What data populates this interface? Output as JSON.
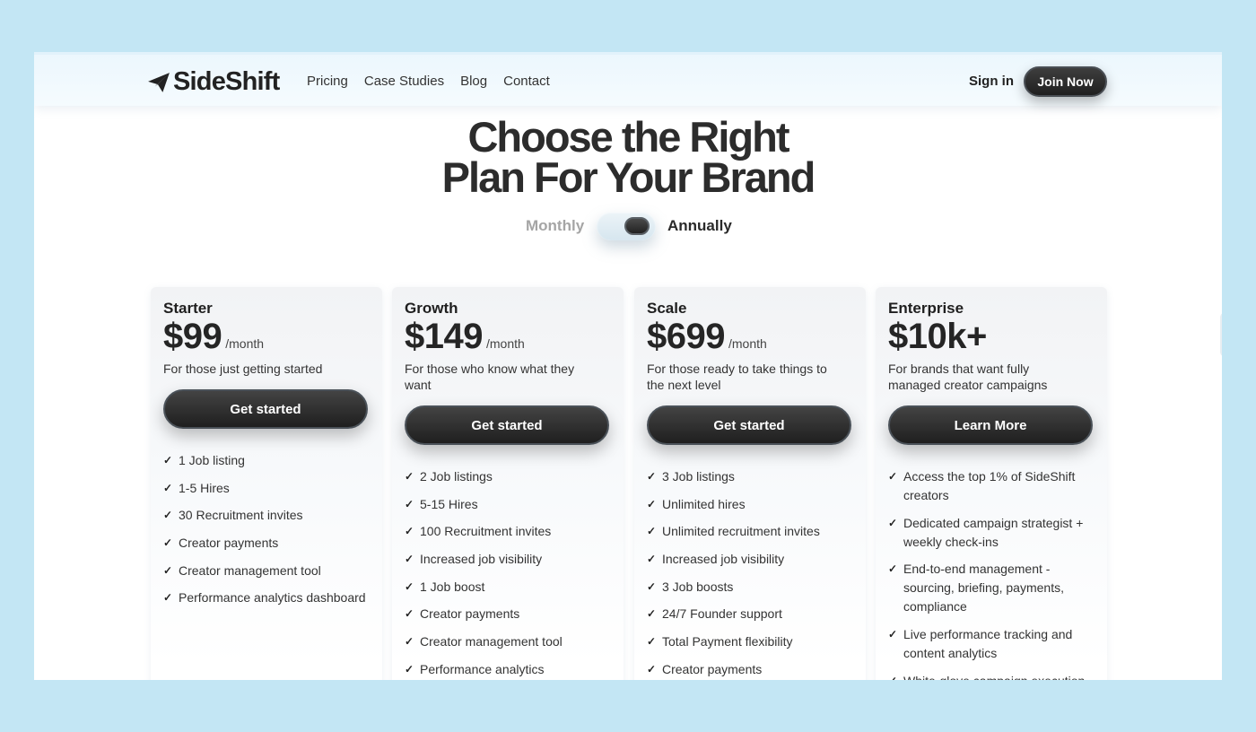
{
  "nav": {
    "brand": "SideShift",
    "links": [
      "Pricing",
      "Case Studies",
      "Blog",
      "Contact"
    ],
    "signin": "Sign in",
    "join": "Join Now"
  },
  "hero": {
    "title_line1": "Choose the Right",
    "title_line2": "Plan For Your Brand"
  },
  "billing": {
    "monthly": "Monthly",
    "annually": "Annually",
    "selected": "Annually"
  },
  "plans": [
    {
      "name": "Starter",
      "price": "$99",
      "per": "/month",
      "desc": "For those just getting started",
      "cta": "Get started",
      "features": [
        "1 Job listing",
        "1-5 Hires",
        "30 Recruitment invites",
        "Creator payments",
        "Creator management tool",
        "Performance analytics dashboard"
      ]
    },
    {
      "name": "Growth",
      "price": "$149",
      "per": "/month",
      "desc": "For those who know what they want",
      "cta": "Get started",
      "features": [
        "2 Job listings",
        "5-15 Hires",
        "100 Recruitment invites",
        "Increased job visibility",
        "1 Job boost",
        "Creator payments",
        "Creator management tool",
        "Performance analytics"
      ]
    },
    {
      "name": "Scale",
      "price": "$699",
      "per": "/month",
      "desc": "For those ready to take things to the next level",
      "cta": "Get started",
      "features": [
        "3 Job listings",
        "Unlimited hires",
        "Unlimited recruitment invites",
        "Increased job visibility",
        "3 Job boosts",
        "24/7 Founder support",
        "Total Payment flexibility",
        "Creator payments"
      ]
    },
    {
      "name": "Enterprise",
      "price": "$10k+",
      "per": "",
      "desc": "For brands that want fully managed creator campaigns",
      "cta": "Learn More",
      "features": [
        "Access the top 1% of SideShift creators",
        "Dedicated campaign strategist + weekly check-ins",
        "End-to-end management - sourcing, briefing, payments, compliance",
        "Live performance tracking and content analytics",
        "White-glove campaign execution"
      ]
    }
  ],
  "colors": {
    "background": "#c3e6f4",
    "button": "#2b2b2b",
    "accent_border": "#4a5158"
  },
  "icons": {
    "logo": "paper-plane-icon",
    "feature": "check-icon"
  }
}
